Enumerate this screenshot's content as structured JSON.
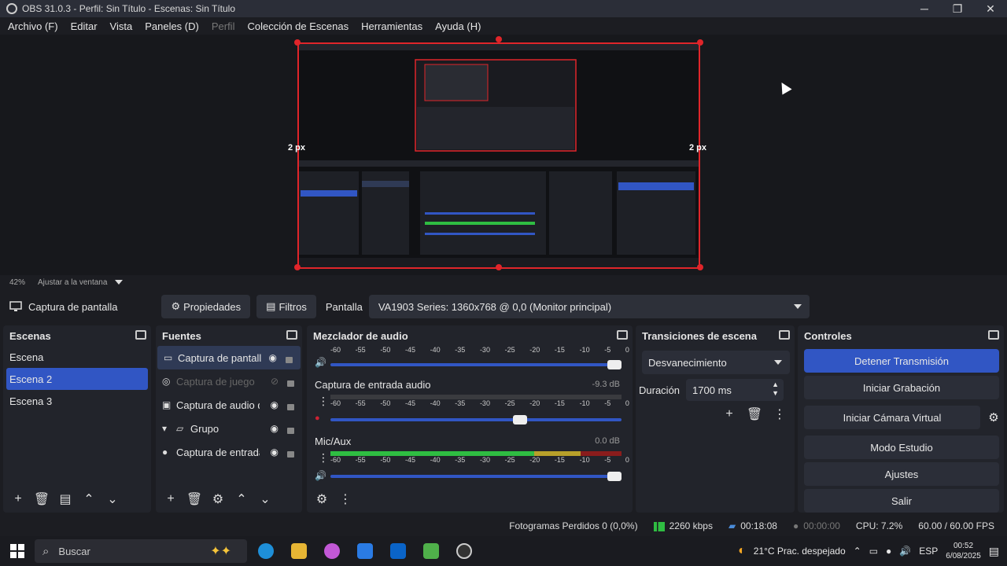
{
  "window": {
    "title": "OBS 31.0.3 - Perfil: Sin Título - Escenas: Sin Título",
    "controls": [
      "minimize",
      "maximize",
      "close"
    ]
  },
  "menu": [
    {
      "label": "Archivo (F)",
      "enabled": true
    },
    {
      "label": "Editar",
      "enabled": true
    },
    {
      "label": "Vista",
      "enabled": true
    },
    {
      "label": "Paneles (D)",
      "enabled": true
    },
    {
      "label": "Perfil",
      "enabled": false
    },
    {
      "label": "Colección de Escenas",
      "enabled": true
    },
    {
      "label": "Herramientas",
      "enabled": true
    },
    {
      "label": "Ayuda (H)",
      "enabled": true
    }
  ],
  "preview": {
    "left_px_label": "2 px",
    "right_px_label": "2 px",
    "border_color": "#e0252a"
  },
  "zoom": {
    "percent": "42%",
    "fit_label": "Ajustar a la ventana"
  },
  "source_toolbar": {
    "selected_source": "Captura de pantalla",
    "properties_label": "Propiedades",
    "filters_label": "Filtros",
    "display_label": "Pantalla",
    "display_value": "VA1903 Series: 1360x768 @ 0,0 (Monitor principal)"
  },
  "scenes": {
    "title": "Escenas",
    "items": [
      {
        "label": "Escena",
        "selected": false
      },
      {
        "label": "Escena 2",
        "selected": true
      },
      {
        "label": "Escena 3",
        "selected": false
      }
    ]
  },
  "sources": {
    "title": "Fuentes",
    "items": [
      {
        "label": "Captura de pantalla",
        "icon": "monitor-icon",
        "selected": true,
        "enabled": true
      },
      {
        "label": "Captura de juego",
        "icon": "gamepad-icon",
        "selected": false,
        "enabled": false
      },
      {
        "label": "Captura de audio de",
        "icon": "window-icon",
        "selected": false,
        "enabled": true
      },
      {
        "label": "Grupo",
        "icon": "folder-icon",
        "selected": false,
        "enabled": true
      },
      {
        "label": "Captura de entrada",
        "icon": "mic-icon",
        "selected": false,
        "enabled": true
      }
    ]
  },
  "mixer": {
    "title": "Mezclador de audio",
    "scale": [
      "-60",
      "-55",
      "-50",
      "-45",
      "-40",
      "-35",
      "-30",
      "-25",
      "-20",
      "-15",
      "-10",
      "-5",
      "0"
    ],
    "channels": [
      {
        "name": "",
        "db": "",
        "volume": 1.0,
        "level": 0.0
      },
      {
        "name": "Captura de entrada audio",
        "db": "-9.3 dB",
        "volume": 0.66,
        "level": 0.0
      },
      {
        "name": "Mic/Aux",
        "db": "0.0 dB",
        "volume": 1.0,
        "level": 0.78
      }
    ]
  },
  "transitions": {
    "title": "Transiciones de escena",
    "selected": "Desvanecimiento",
    "duration_label": "Duración",
    "duration_value": "1700 ms"
  },
  "controls": {
    "title": "Controles",
    "buttons": [
      {
        "label": "Detener Transmisión",
        "primary": true
      },
      {
        "label": "Iniciar Grabación",
        "primary": false
      },
      {
        "label": "Iniciar Cámara Virtual",
        "primary": false
      },
      {
        "label": "Modo Estudio",
        "primary": false
      },
      {
        "label": "Ajustes",
        "primary": false
      },
      {
        "label": "Salir",
        "primary": false
      }
    ]
  },
  "status": {
    "dropped_frames": "Fotogramas Perdidos 0 (0,0%)",
    "bitrate": "2260 kbps",
    "stream_time": "00:18:08",
    "rec_time": "00:00:00",
    "cpu": "CPU: 7.2%",
    "fps": "60.00 / 60.00 FPS"
  },
  "taskbar": {
    "search_placeholder": "Buscar",
    "weather": "21°C  Prac. despejado",
    "lang": "ESP",
    "time": "00:52",
    "date": "6/08/2025"
  },
  "colors": {
    "accent": "#3156c4",
    "panel": "#22242b",
    "recording_red": "#e0252a",
    "meter_green": "#2fbd42"
  }
}
